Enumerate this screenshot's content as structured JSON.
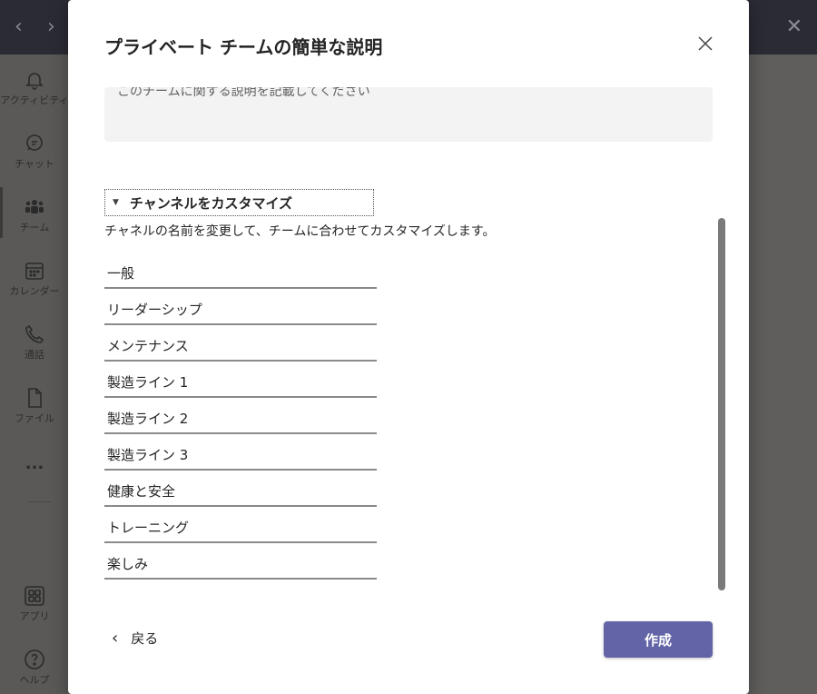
{
  "rail": {
    "items": [
      {
        "label": "アクティビティ",
        "icon": "bell-icon"
      },
      {
        "label": "チャット",
        "icon": "chat-icon"
      },
      {
        "label": "チーム",
        "icon": "teams-icon"
      },
      {
        "label": "カレンダー",
        "icon": "calendar-icon"
      },
      {
        "label": "通話",
        "icon": "phone-icon"
      },
      {
        "label": "ファイル",
        "icon": "file-icon"
      },
      {
        "label": "...",
        "icon": "more-icon"
      },
      {
        "label": "アプリ",
        "icon": "apps-icon"
      },
      {
        "label": "ヘルプ",
        "icon": "help-icon"
      }
    ]
  },
  "dialog": {
    "title": "プライベート チームの簡単な説明",
    "description_placeholder": "このチームに関する説明を記載してください",
    "customize_label": "チャンネルをカスタマイズ",
    "helper_text": "チャネルの名前を変更して、チームに合わせてカスタマイズします。",
    "channels": [
      "一般",
      "リーダーシップ",
      "メンテナンス",
      "製造ライン 1",
      "製造ライン 2",
      "製造ライン 3",
      "健康と安全",
      "トレーニング",
      "楽しみ"
    ],
    "back_label": "戻る",
    "create_label": "作成"
  },
  "colors": {
    "accent": "#6264a7",
    "titlebar": "#2b2b35"
  }
}
